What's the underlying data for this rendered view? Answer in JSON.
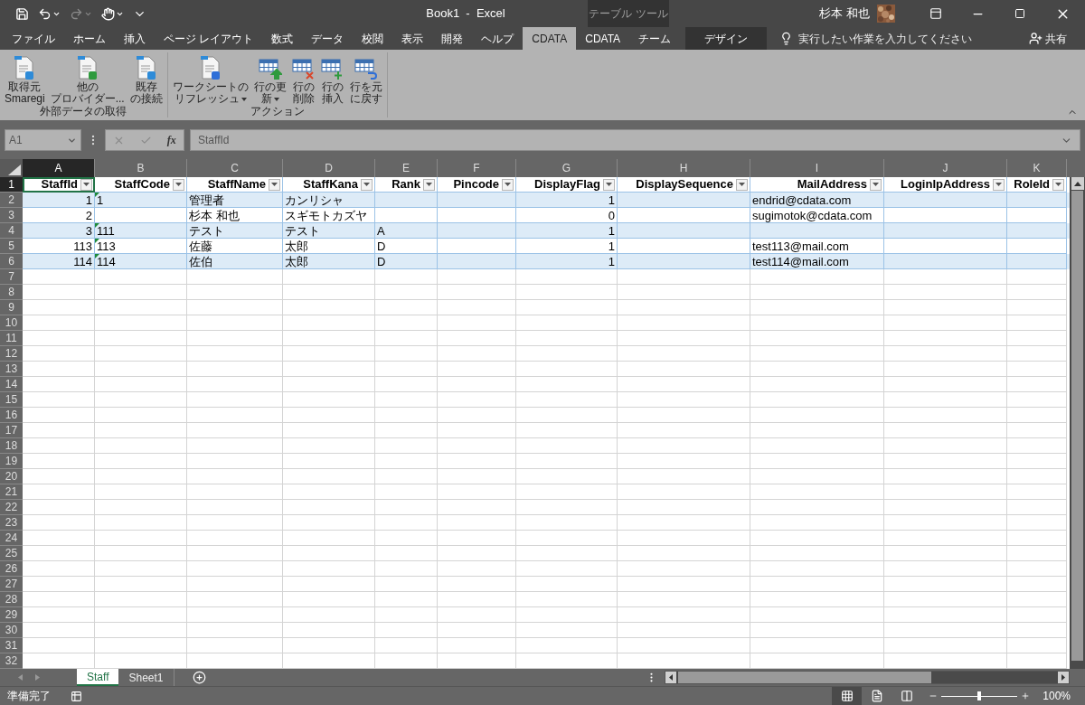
{
  "quick_access": [
    {
      "kind": "save",
      "disabled": false,
      "dropdown": false
    },
    {
      "kind": "undo",
      "disabled": false,
      "dropdown": true
    },
    {
      "kind": "redo",
      "disabled": true,
      "dropdown": true
    },
    {
      "kind": "touch",
      "disabled": false,
      "dropdown": true
    },
    {
      "kind": "customize",
      "disabled": false,
      "dropdown": false
    }
  ],
  "window": {
    "title": "Book1  -  Excel",
    "user": "杉本 和也"
  },
  "contextual_group": "テーブル ツール",
  "ribbon_tabs": [
    {
      "label": "ファイル",
      "selected": false,
      "contextual": false
    },
    {
      "label": "ホーム",
      "selected": false,
      "contextual": false
    },
    {
      "label": "挿入",
      "selected": false,
      "contextual": false
    },
    {
      "label": "ページ レイアウト",
      "selected": false,
      "contextual": false
    },
    {
      "label": "数式",
      "selected": false,
      "contextual": false
    },
    {
      "label": "データ",
      "selected": false,
      "contextual": false
    },
    {
      "label": "校閲",
      "selected": false,
      "contextual": false
    },
    {
      "label": "表示",
      "selected": false,
      "contextual": false
    },
    {
      "label": "開発",
      "selected": false,
      "contextual": false
    },
    {
      "label": "ヘルプ",
      "selected": false,
      "contextual": false
    },
    {
      "label": "CDATA",
      "selected": true,
      "contextual": false
    },
    {
      "label": "CDATA",
      "selected": false,
      "contextual": false
    },
    {
      "label": "チーム",
      "selected": false,
      "contextual": false
    },
    {
      "label": "デザイン",
      "selected": false,
      "contextual": true
    }
  ],
  "tell_me": {
    "placeholder": "実行したい作業を入力してください"
  },
  "share": "共有",
  "ribbon_groups": [
    {
      "label": "外部データの取得",
      "buttons": [
        {
          "kind": "doc-cloud",
          "lines": [
            "取得元",
            "Smaregi"
          ],
          "dropdown": false
        },
        {
          "kind": "doc-green",
          "lines": [
            "他の",
            "プロバイダー..."
          ],
          "dropdown": false
        },
        {
          "kind": "doc-db",
          "lines": [
            "既存",
            "の接続"
          ],
          "dropdown": false
        }
      ]
    },
    {
      "label": "アクション",
      "buttons": [
        {
          "kind": "doc-refresh",
          "lines": [
            "ワークシートの",
            "リフレッシュ"
          ],
          "dropdown": true
        },
        {
          "kind": "table-up",
          "lines": [
            "行の更",
            "新"
          ],
          "dropdown": true
        },
        {
          "kind": "table-delete",
          "lines": [
            "行の",
            "削除"
          ],
          "dropdown": false
        },
        {
          "kind": "table-insert",
          "lines": [
            "行の",
            "挿入"
          ],
          "dropdown": false
        },
        {
          "kind": "table-undo",
          "lines": [
            "行を元",
            "に戻す"
          ],
          "dropdown": false
        }
      ]
    }
  ],
  "formula_bar": {
    "name_box": "A1",
    "insert_function": "fx",
    "value": "StaffId"
  },
  "sheet": {
    "column_letters": [
      "A",
      "B",
      "C",
      "D",
      "E",
      "F",
      "G",
      "H",
      "I",
      "J",
      "K"
    ],
    "header_row": {
      "number": "1",
      "cells": [
        {
          "text": "StaffId",
          "kind": "number",
          "selected": true
        },
        {
          "text": "StaffCode",
          "kind": "text",
          "selected": false
        },
        {
          "text": "StaffName",
          "kind": "text",
          "selected": false
        },
        {
          "text": "StaffKana",
          "kind": "text",
          "selected": false
        },
        {
          "text": "Rank",
          "kind": "text",
          "selected": false
        },
        {
          "text": "Pincode",
          "kind": "text",
          "selected": false
        },
        {
          "text": "DisplayFlag",
          "kind": "number",
          "selected": false
        },
        {
          "text": "DisplaySequence",
          "kind": "text",
          "selected": false
        },
        {
          "text": "MailAddress",
          "kind": "text",
          "selected": false
        },
        {
          "text": "LoginIpAddress",
          "kind": "text",
          "selected": false
        },
        {
          "text": "RoleId",
          "kind": "text",
          "selected": false
        }
      ]
    },
    "data_rows": [
      {
        "number": "2",
        "warning": true,
        "cells": [
          "1",
          "1",
          "管理者",
          "カンリシャ",
          null,
          null,
          "1",
          null,
          "endrid@cdata.com",
          null,
          null
        ]
      },
      {
        "number": "3",
        "warning": false,
        "cells": [
          "2",
          null,
          "杉本 和也",
          "スギモトカズヤ",
          null,
          null,
          "0",
          null,
          "sugimotok@cdata.com",
          null,
          null
        ]
      },
      {
        "number": "4",
        "warning": true,
        "cells": [
          "3",
          "111",
          "テスト",
          "テスト",
          "A",
          null,
          "1",
          null,
          null,
          null,
          null
        ]
      },
      {
        "number": "5",
        "warning": true,
        "cells": [
          "113",
          "113",
          "佐藤",
          "太郎",
          "D",
          null,
          "1",
          null,
          "test113@mail.com",
          null,
          null
        ]
      },
      {
        "number": "6",
        "warning": true,
        "cells": [
          "114",
          "114",
          "佐伯",
          "太郎",
          "D",
          null,
          "1",
          null,
          "test114@mail.com",
          null,
          null
        ]
      }
    ],
    "empty_rows": [
      "7",
      "8",
      "9",
      "10",
      "11",
      "12",
      "13",
      "14",
      "15",
      "16",
      "17",
      "18",
      "19",
      "20",
      "21",
      "22",
      "23",
      "24",
      "25",
      "26",
      "27",
      "28",
      "29",
      "30",
      "31",
      "32"
    ]
  },
  "sheet_tabs": [
    {
      "label": "Staff",
      "selected": true
    },
    {
      "label": "Sheet1",
      "selected": false
    }
  ],
  "status_bar": {
    "text": "準備完了",
    "views": [
      {
        "kind": "normal",
        "selected": true
      },
      {
        "kind": "page-layout",
        "selected": false
      },
      {
        "kind": "page-break",
        "selected": false
      }
    ],
    "zoom": {
      "level": 0.5,
      "reading": "100%"
    }
  }
}
